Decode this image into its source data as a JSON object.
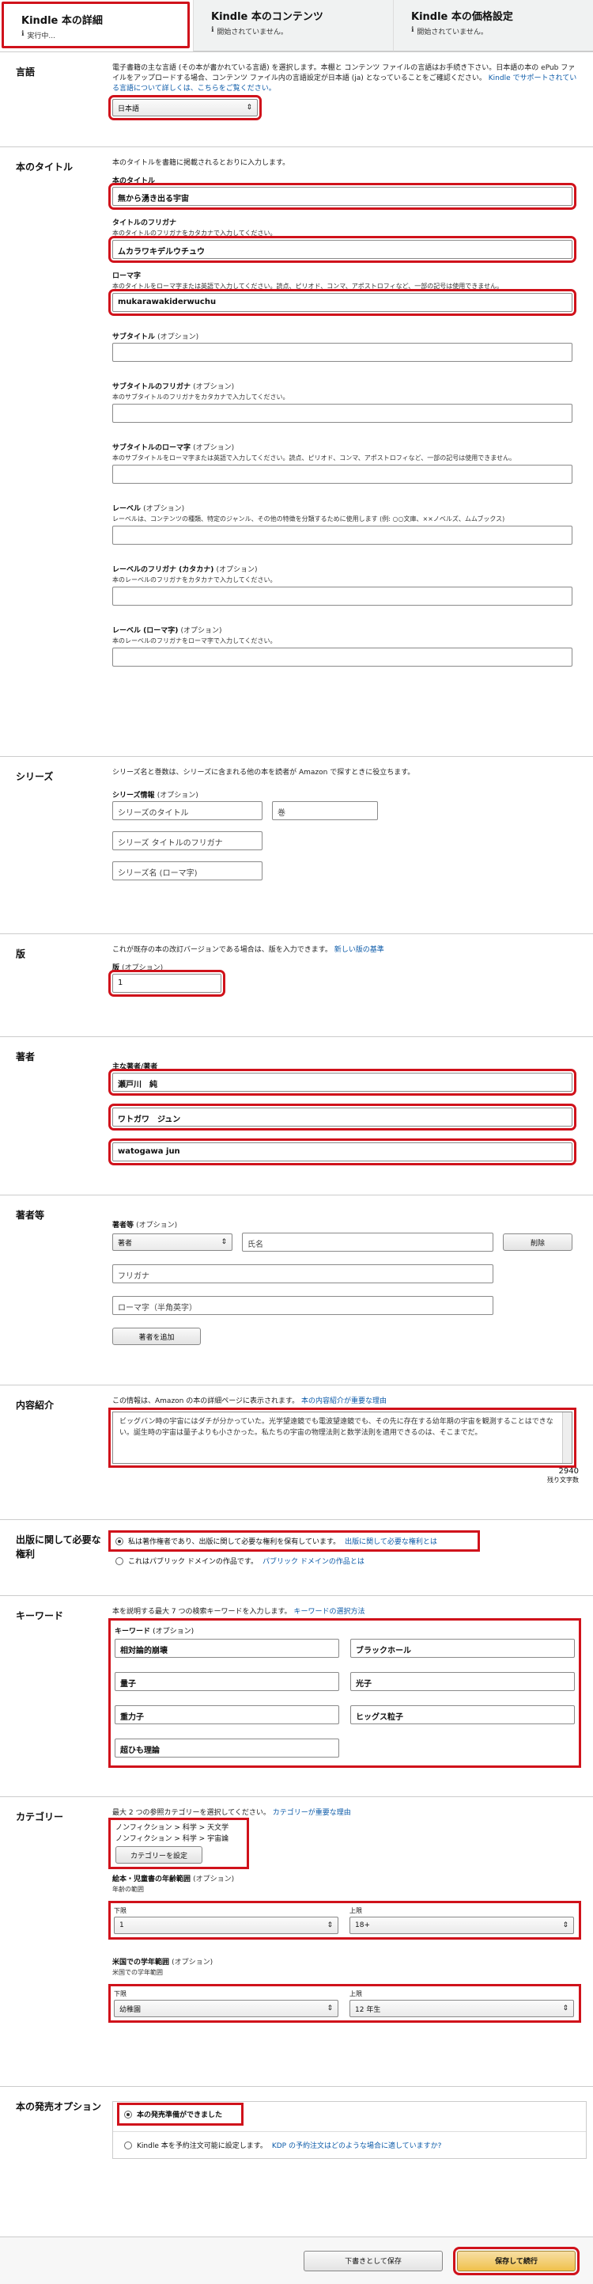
{
  "tabs": [
    {
      "title": "Kindle 本の詳細",
      "status": "実行中..."
    },
    {
      "title": "Kindle 本のコンテンツ",
      "status": "開始されていません。"
    },
    {
      "title": "Kindle 本の価格設定",
      "status": "開始されていません。"
    }
  ],
  "language": {
    "label": "言語",
    "help": "電子書籍の主な言語 (その本が書かれている言語) を選択します。本棚と コンテンツ ファイルの言語はお手続き下さい。日本語の本の ePub ファイルをアップロードする場合、コンテンツ ファイル内の言語設定が日本語 (ja) となっていることをご確認ください。",
    "help_link": "Kindle でサポートされている言語について詳しくは、こちらをご覧ください。",
    "value": "日本語"
  },
  "title_section": {
    "label": "本のタイトル",
    "intro": "本のタイトルを書籍に掲載されるとおりに入力します。",
    "fields": [
      {
        "label": "本のタイトル",
        "opt": "",
        "help": "",
        "value": "無から湧き出る宇宙",
        "highlight": true
      },
      {
        "label": "タイトルのフリガナ",
        "opt": "",
        "help": "本のタイトルのフリガナをカタカナで入力してください。",
        "value": "ムカラワキデルウチュウ",
        "highlight": true
      },
      {
        "label": "ローマ字",
        "opt": "",
        "help": "本のタイトルをローマ字または英語で入力してください。読点、ピリオド、コンマ、アポストロフィなど、一部の記号は使用できません。",
        "value": "mukarawakiderwuchu",
        "highlight": true
      },
      {
        "label": "サブタイトル",
        "opt": "(オプション)",
        "help": "",
        "value": "",
        "highlight": false
      },
      {
        "label": "サブタイトルのフリガナ",
        "opt": "(オプション)",
        "help": "本のサブタイトルのフリガナをカタカナで入力してください。",
        "value": "",
        "highlight": false
      },
      {
        "label": "サブタイトルのローマ字",
        "opt": "(オプション)",
        "help": "本のサブタイトルをローマ字または英語で入力してください。読点、ピリオド、コンマ、アポストロフィなど、一部の記号は使用できません。",
        "value": "",
        "highlight": false
      },
      {
        "label": "レーベル",
        "opt": "(オプション)",
        "help": "レーベルは、コンテンツの種類、特定のジャンル、その他の特徴を分類するために使用します (例: ○○文庫、××ノベルズ、ムムブックス)",
        "value": "",
        "highlight": false
      },
      {
        "label": "レーベルのフリガナ (カタカナ)",
        "opt": "(オプション)",
        "help": "本のレーベルのフリガナをカタカナで入力してください。",
        "value": "",
        "highlight": false
      },
      {
        "label": "レーベル (ローマ字)",
        "opt": "(オプション)",
        "help": "本のレーベルのフリガナをローマ字で入力してください。",
        "value": "",
        "highlight": false
      }
    ]
  },
  "series": {
    "label": "シリーズ",
    "help": "シリーズ名と巻数は、シリーズに含まれる他の本を読者が Amazon で探すときに役立ちます。",
    "field_label": "シリーズ情報",
    "opt": "(オプション)",
    "placeholder_title": "シリーズのタイトル",
    "placeholder_volume": "巻",
    "placeholder_kana": "シリーズ タイトルのフリガナ",
    "placeholder_roman": "シリーズ名 (ローマ字)"
  },
  "edition": {
    "label": "版",
    "help": "これが既存の本の改訂バージョンである場合は、版を入力できます。",
    "help_link": "新しい版の基準",
    "field_label": "版",
    "opt": "(オプション)",
    "value": "1"
  },
  "author": {
    "label": "著者",
    "field_label": "主な著者/著者",
    "name": "瀬戸川　純",
    "kana": "ワトガワ　ジュン",
    "roman": "watogawa jun"
  },
  "contributors": {
    "label": "著者等",
    "field_label": "著者等",
    "opt": "(オプション)",
    "role": "著者",
    "placeholder_name": "氏名",
    "remove_label": "削除",
    "placeholder_kana": "フリガナ",
    "placeholder_roman": "ローマ字（半角英字）",
    "add_label": "著者を追加"
  },
  "description": {
    "label": "内容紹介",
    "help": "この情報は、Amazon の本の詳細ページに表示されます。",
    "help_link": "本の内容紹介が重要な理由",
    "text": "ビッグバン時の宇宙にはダチが分かっていた。光学望遠鏡でも電波望遠鏡でも、その先に存在する幼年期の宇宙を観測することはできない。誕生時の宇宙は量子よりも小さかった。私たちの宇宙の物理法則と数学法則を適用できるのは、そこまでだ。",
    "count": "2940",
    "count_label": "残り文字数"
  },
  "rights": {
    "label": "出版に関して必要な権利",
    "option1": "私は著作権者であり、出版に関して必要な権利を保有しています。",
    "option1_link": "出版に関して必要な権利とは",
    "option2": "これはパブリック ドメインの作品です。",
    "option2_link": "パブリック ドメインの作品とは"
  },
  "keywords": {
    "label": "キーワード",
    "help": "本を説明する最大 7 つの検索キーワードを入力します。",
    "help_link": "キーワードの選択方法",
    "field_label": "キーワード",
    "opt": "(オプション)",
    "values": [
      "相対論的崩壊",
      "ブラックホール",
      "量子",
      "光子",
      "重力子",
      "ヒッグス粒子",
      "超ひも理論"
    ]
  },
  "categories": {
    "label": "カテゴリー",
    "help": "最大 2 つの参照カテゴリーを選択してください。",
    "help_link": "カテゴリーが重要な理由",
    "selected": [
      "ノンフィクション > 科学 > 天文学",
      "ノンフィクション > 科学 > 宇宙論"
    ],
    "set_button": "カテゴリーを設定",
    "age_label": "絵本・児童書の年齢範囲",
    "age_opt": "(オプション)",
    "age_help": "年齢の範囲",
    "min_label": "下限",
    "max_label": "上限",
    "age_min": "1",
    "age_max": "18+",
    "grade_label": "米国での学年範囲",
    "grade_opt": "(オプション)",
    "grade_help": "米国での学年範囲",
    "grade_min": "幼稚園",
    "grade_max": "12 年生"
  },
  "release": {
    "label": "本の発売オプション",
    "option1": "本の発売準備ができました",
    "option2": "Kindle 本を予約注文可能に設定します。",
    "option2_link": "KDP の予約注文はどのような場合に適していますか?"
  },
  "footer": {
    "draft": "下書きとして保存",
    "continue": "保存して続行"
  }
}
